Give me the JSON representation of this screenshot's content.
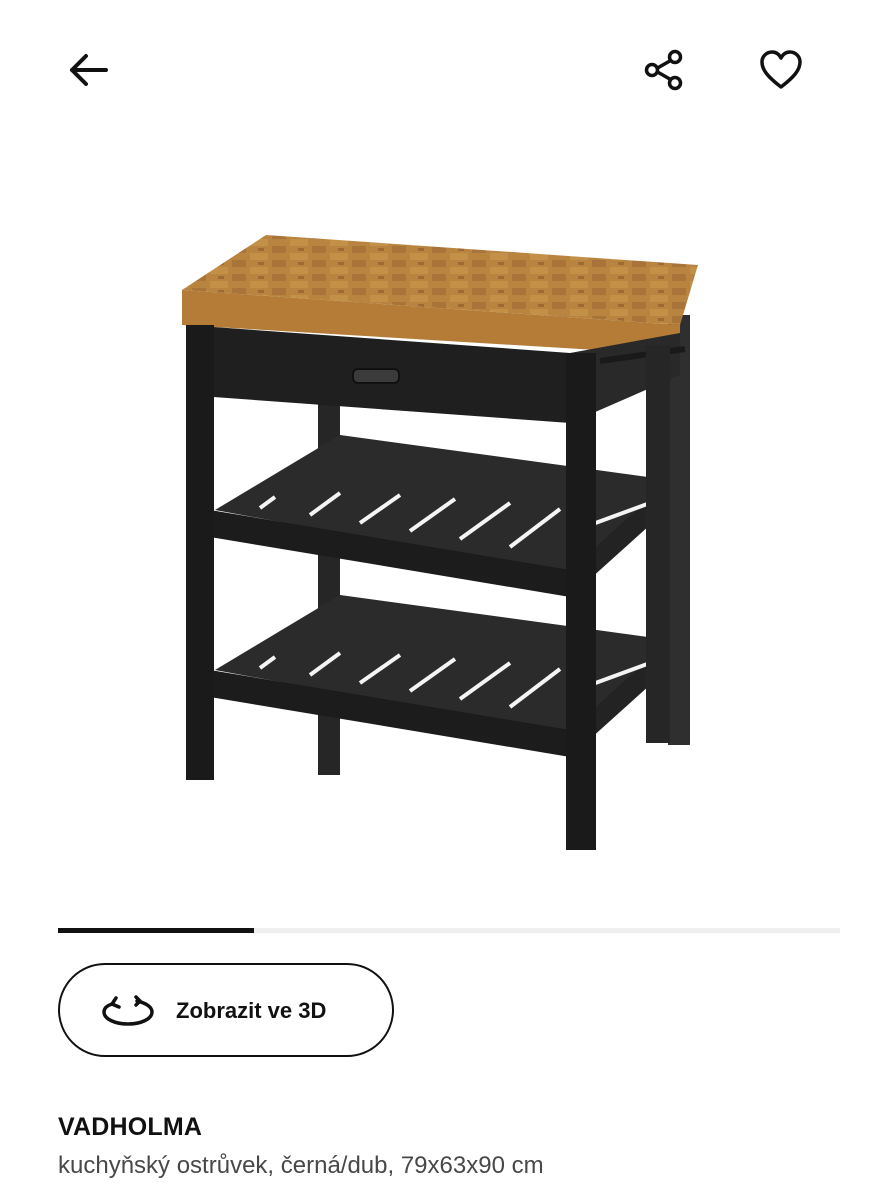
{
  "header": {
    "back_icon": "arrow-left-icon",
    "share_icon": "share-icon",
    "favorite_icon": "heart-outline-icon"
  },
  "gallery": {
    "image_subject": "kitchen island with oak butcher-block top, black frame, drawer and two slatted shelves",
    "progress": 0.25
  },
  "view3d": {
    "icon": "rotate-3d-icon",
    "label": "Zobrazit ve 3D"
  },
  "product": {
    "name": "VADHOLMA",
    "description": "kuchyňský ostrůvek, černá/dub, 79x63x90 cm"
  },
  "colors": {
    "text": "#111111",
    "secondary_text": "#484848",
    "track": "#eeeeee",
    "wood": "#b8843f",
    "frame": "#2a2a2a"
  }
}
